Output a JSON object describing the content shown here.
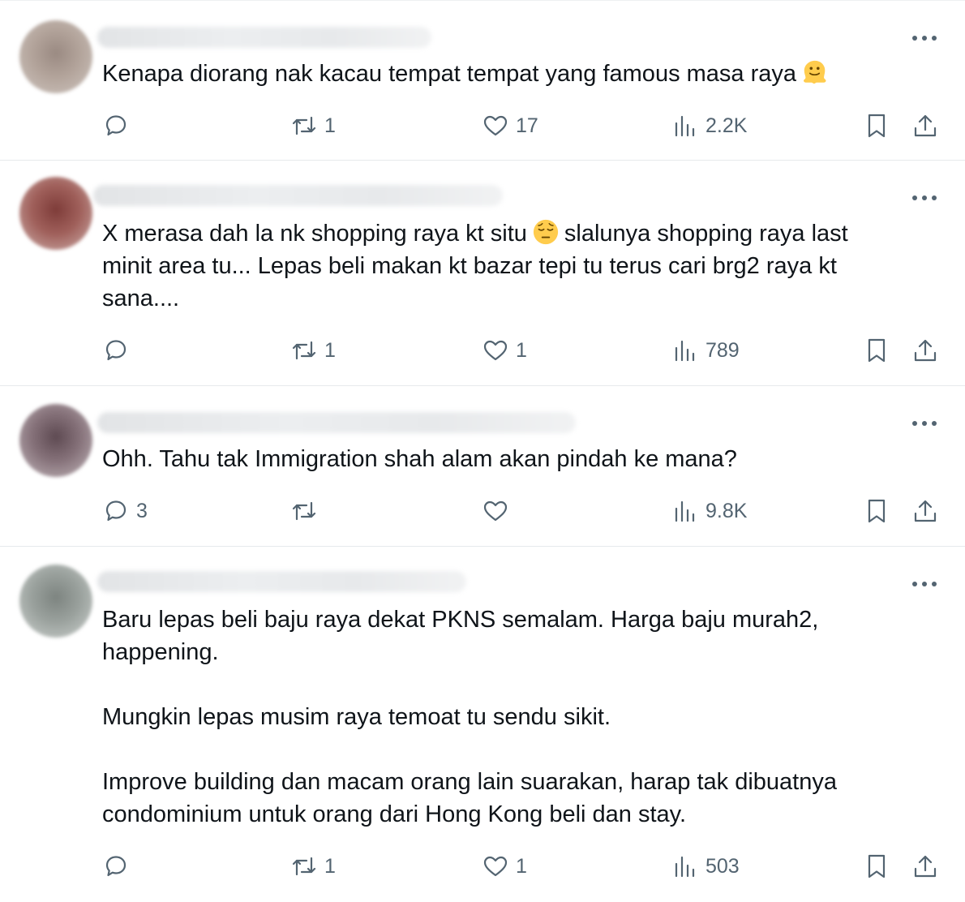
{
  "colors": {
    "text": "#0f1419",
    "muted": "#536471",
    "divider": "#e6e9ec"
  },
  "tweets": [
    {
      "text": "Kenapa diorang nak kacau tempat tempat yang famous masa raya",
      "emoji": "melting-face",
      "replies": "",
      "retweets": "1",
      "likes": "17",
      "views": "2.2K"
    },
    {
      "text_before_emoji": "X merasa dah la nk shopping raya kt situ",
      "emoji": "pensive-face",
      "text_after_emoji": "slalunya shopping raya last minit area tu... Lepas beli makan kt bazar tepi tu terus cari brg2 raya kt sana....",
      "replies": "",
      "retweets": "1",
      "likes": "1",
      "views": "789"
    },
    {
      "text": "Ohh. Tahu tak Immigration shah alam akan pindah ke mana?",
      "replies": "3",
      "retweets": "",
      "likes": "",
      "views": "9.8K"
    },
    {
      "text": "Baru lepas beli baju raya dekat PKNS semalam. Harga baju murah2, happening.\n\nMungkin lepas musim raya temoat tu sendu sikit.\n\nImprove building dan macam orang lain suarakan, harap tak dibuatnya condominium untuk orang dari Hong Kong beli dan stay.",
      "replies": "",
      "retweets": "1",
      "likes": "1",
      "views": "503"
    }
  ]
}
